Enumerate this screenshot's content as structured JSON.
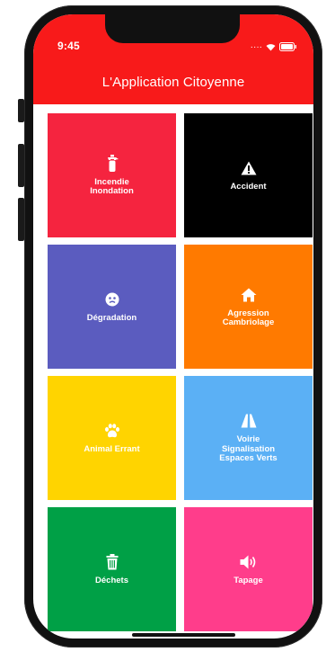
{
  "status_bar": {
    "time": "9:45",
    "signal_icon": "signal-icon",
    "wifi_icon": "wifi-icon",
    "battery_icon": "battery-icon"
  },
  "header": {
    "title": "L'Application Citoyenne",
    "background": "#f81a1a"
  },
  "tiles": [
    {
      "label": "Incendie\nInondation",
      "icon": "fire-extinguisher-icon",
      "color": "#f5243f"
    },
    {
      "label": "Accident",
      "icon": "warning-icon",
      "color": "#000000"
    },
    {
      "label": "Dégradation",
      "icon": "damage-icon",
      "color": "#5b5cbf"
    },
    {
      "label": "Agression\nCambriolage",
      "icon": "home-icon",
      "color": "#ff7a00"
    },
    {
      "label": "Animal Errant",
      "icon": "paw-icon",
      "color": "#ffd400"
    },
    {
      "label": "Voirie\nSignalisation\nEspaces Verts",
      "icon": "road-icon",
      "color": "#5bb0f5"
    },
    {
      "label": "Déchets",
      "icon": "trash-icon",
      "color": "#00a046"
    },
    {
      "label": "Tapage",
      "icon": "speaker-icon",
      "color": "#ff3d8b"
    }
  ]
}
